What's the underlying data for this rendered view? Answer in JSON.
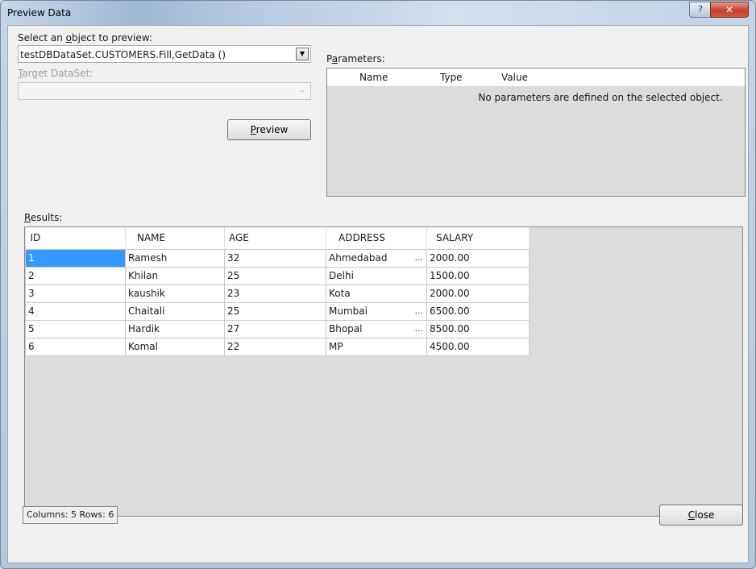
{
  "window": {
    "title": "Preview Data",
    "help_label": "?",
    "close_label": "✕"
  },
  "select_object": {
    "label_pre": "Select an ",
    "label_key": "o",
    "label_post": "bject to preview:",
    "value": "testDBDataSet.CUSTOMERS.Fill,GetData ()"
  },
  "target_dataset": {
    "label_key": "T",
    "label_post": "arget DataSet:",
    "value": ""
  },
  "preview_button": {
    "key": "P",
    "rest": "review"
  },
  "parameters": {
    "label_pre": "P",
    "label_key": "a",
    "label_post": "rameters:",
    "columns": [
      "Name",
      "Type",
      "Value"
    ],
    "empty_message": "No parameters are defined on the selected object."
  },
  "results": {
    "label_key": "R",
    "label_post": "esults:",
    "columns": [
      "ID",
      "NAME",
      "AGE",
      "ADDRESS",
      "SALARY"
    ],
    "rows": [
      {
        "id": "1",
        "name": "Ramesh",
        "age": "32",
        "address": "Ahmedabad",
        "salary": "2000.00",
        "more": "..."
      },
      {
        "id": "2",
        "name": "Khilan",
        "age": "25",
        "address": "Delhi",
        "salary": "1500.00",
        "more": ""
      },
      {
        "id": "3",
        "name": "kaushik",
        "age": "23",
        "address": "Kota",
        "salary": "2000.00",
        "more": ""
      },
      {
        "id": "4",
        "name": "Chaitali",
        "age": "25",
        "address": "Mumbai",
        "salary": "6500.00",
        "more": "..."
      },
      {
        "id": "5",
        "name": "Hardik",
        "age": "27",
        "address": "Bhopal",
        "salary": "8500.00",
        "more": "..."
      },
      {
        "id": "6",
        "name": "Komal",
        "age": "22",
        "address": "MP",
        "salary": "4500.00",
        "more": ""
      }
    ]
  },
  "status": {
    "text": "Columns: 5   Rows: 6"
  },
  "close_button": {
    "key": "C",
    "rest": "lose"
  }
}
